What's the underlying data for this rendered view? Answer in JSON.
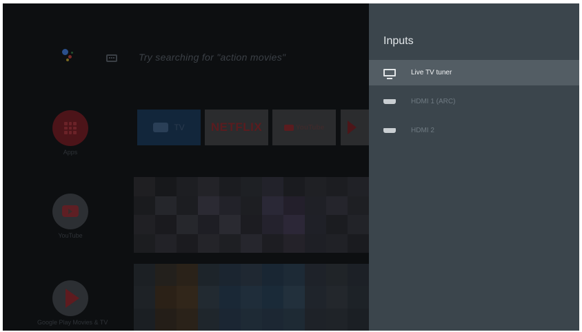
{
  "home": {
    "search_hint": "Try searching for \"action movies\"",
    "side_items": [
      {
        "label": "Apps"
      },
      {
        "label": "YouTube"
      },
      {
        "label": "Google Play Movies & TV"
      }
    ],
    "channel_tiles": [
      {
        "label": "TV"
      },
      {
        "label": "NETFLIX"
      },
      {
        "label": "YouTube"
      }
    ]
  },
  "inputs_panel": {
    "title": "Inputs",
    "items": [
      {
        "label": "Live TV tuner",
        "icon": "tv-icon",
        "selected": true
      },
      {
        "label": "HDMI 1 (ARC)",
        "icon": "hdmi-port-icon",
        "selected": false
      },
      {
        "label": "HDMI 2",
        "icon": "hdmi-port-icon",
        "selected": false
      }
    ]
  },
  "colors": {
    "panel_bg": "#3b454c",
    "selected_row": "#535d64",
    "screen_bg": "#0d0f11"
  }
}
